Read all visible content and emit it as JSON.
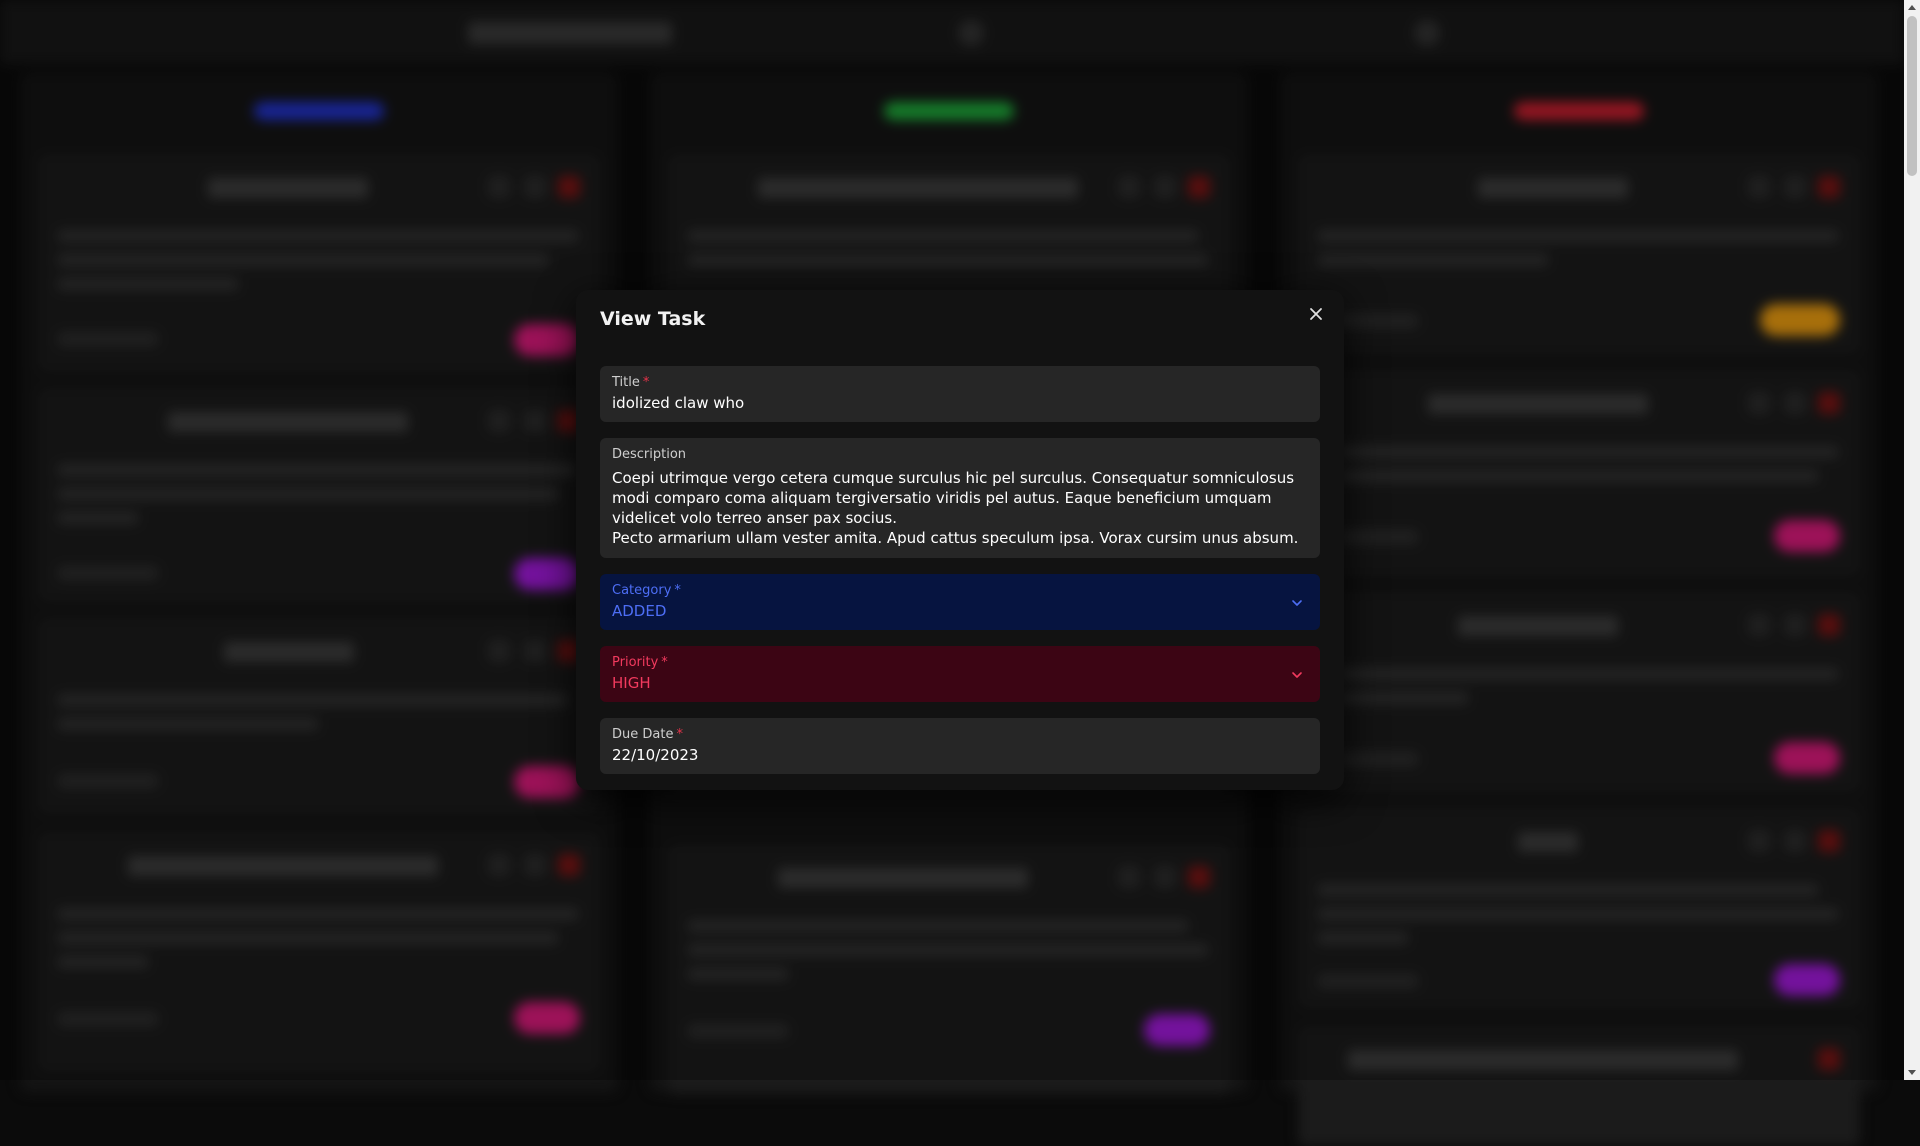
{
  "modal": {
    "title": "View Task",
    "fields": {
      "title": {
        "label": "Title",
        "required_mark": "*",
        "value": "idolized claw who"
      },
      "description": {
        "label": "Description",
        "paragraphs": [
          "Coepi utrimque vergo cetera cumque surculus hic pel surculus. Consequatur somniculosus modi comparo coma aliquam tergiversatio viridis pel autus. Eaque beneficium umquam videlicet volo terreo anser pax socius.",
          "Pecto armarium ullam vester amita. Apud cattus speculum ipsa. Vorax cursim unus absum."
        ]
      },
      "category": {
        "label": "Category",
        "required_mark": "*",
        "value": "ADDED"
      },
      "priority": {
        "label": "Priority",
        "required_mark": "*",
        "value": "HIGH"
      },
      "due_date": {
        "label": "Due Date",
        "required_mark": "*",
        "value": "22/10/2023"
      }
    }
  },
  "icons": {
    "close": "close-icon",
    "category_dropdown": "chevron-down-icon",
    "priority_dropdown": "chevron-down-icon"
  },
  "colors": {
    "category_bg": "#061440",
    "category_text": "#4d6ef5",
    "priority_bg": "#3c0514",
    "priority_text": "#f23a5e",
    "required_mark": "#e8334a",
    "column_added_accent": "#2233cc",
    "column_progress_accent": "#1faa3a",
    "column_done_accent": "#cc1f2f"
  }
}
